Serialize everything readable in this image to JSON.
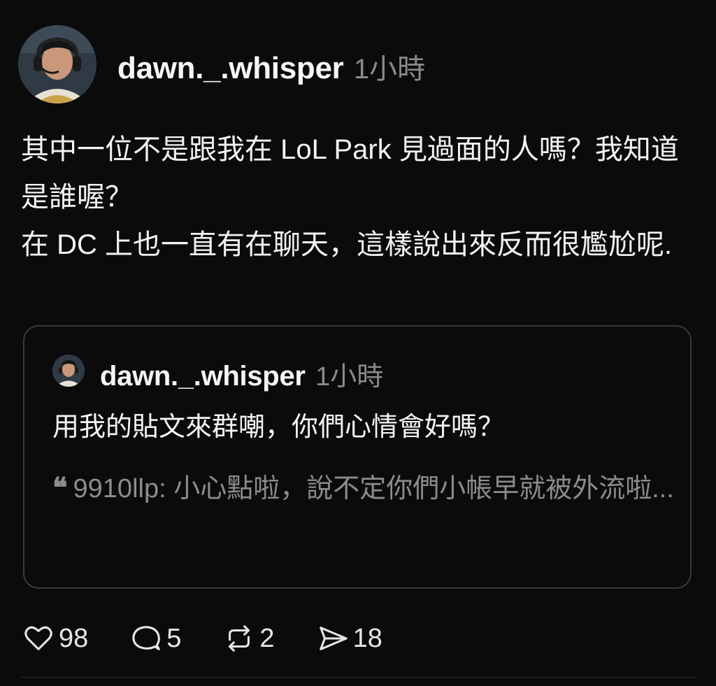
{
  "post": {
    "username": "dawn._.whisper",
    "time": "1小時",
    "body_lines": [
      "其中一位不是跟我在 LoL Park 見過面的人嗎？我知道是誰喔？",
      "在 DC 上也一直有在聊天，這樣說出來反而很尷尬呢."
    ]
  },
  "quoted_post": {
    "username": "dawn._.whisper",
    "time": "1小時",
    "text": "用我的貼文來群嘲，你們心情會好嗎？",
    "nested_quote": {
      "mark": "❝",
      "text": "9910llp: 小心點啦，說不定你們小帳早就被外流啦..."
    }
  },
  "actions": {
    "like": {
      "icon": "heart-icon",
      "count": "98"
    },
    "reply": {
      "icon": "comment-icon",
      "count": "5"
    },
    "repost": {
      "icon": "repost-icon",
      "count": "2"
    },
    "share": {
      "icon": "send-icon",
      "count": "18"
    }
  }
}
